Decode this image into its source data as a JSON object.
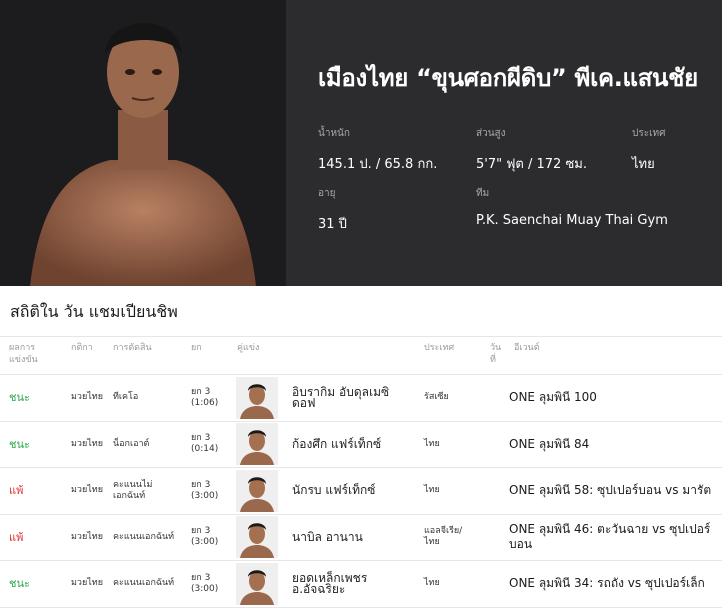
{
  "fighter": {
    "name": "เมืองไทย “ขุนศอกผีดิบ” พีเค.แสนชัย",
    "weight_label": "น้ำหนัก",
    "weight_value": "145.1 ป. / 65.8 กก.",
    "height_label": "ส่วนสูง",
    "height_value": "5'7\" ฟุต / 172 ซม.",
    "country_label": "ประเทศ",
    "country_value": "ไทย",
    "age_label": "อายุ",
    "age_value": "31 ปี",
    "team_label": "ทีม",
    "team_value": "P.K. Saenchai Muay Thai Gym"
  },
  "stats": {
    "title": "สถิติใน วัน แชมเปียนชิพ",
    "headers": {
      "result": "ผลการแข่งขัน",
      "rules": "กติกา",
      "method": "การตัดสิน",
      "round": "ยก",
      "opponent": "คู่แข่ง",
      "country": "ประเทศ",
      "date": "วันที่",
      "event": "อีเวนต์"
    },
    "rows": [
      {
        "result": "ชนะ",
        "rules": "มวยไทย",
        "method": "ทีเคโอ",
        "round": "ยก 3\n(1:06)",
        "opponent": "อิบรากิม อับดุลเมซิดอฟ",
        "country": "รัสเซีย",
        "event": "ONE ลุมพินี 100"
      },
      {
        "result": "ชนะ",
        "rules": "มวยไทย",
        "method": "น็อกเอาต์",
        "round": "ยก 3\n(0:14)",
        "opponent": "ก้องศึก แฟร์เท็กซ์",
        "country": "ไทย",
        "event": "ONE ลุมพินี 84"
      },
      {
        "result": "แพ้",
        "rules": "มวยไทย",
        "method": "คะแนนไม่\nเอกฉันท์",
        "round": "ยก 3\n(3:00)",
        "opponent": "นักรบ แฟร์เท็กซ์",
        "country": "ไทย",
        "event": "ONE ลุมพินี 58: ซุปเปอร์บอน vs มารัต"
      },
      {
        "result": "แพ้",
        "rules": "มวยไทย",
        "method": "คะแนนเอกฉันท์",
        "round": "ยก 3\n(3:00)",
        "opponent": "นาบิล อานาน",
        "country": "แอลจีเรีย/\nไทย",
        "event": "ONE ลุมพินี 46: ตะวันฉาย vs ซุปเปอร์\nบอน"
      },
      {
        "result": "ชนะ",
        "rules": "มวยไทย",
        "method": "คะแนนเอกฉันท์",
        "round": "ยก 3\n(3:00)",
        "opponent": "ยอดเหล็กเพชร\nอ.อัจฉริยะ",
        "country": "ไทย",
        "event": "ONE ลุมพินี 34: รถถัง vs ซุปเปอร์เล็ก"
      }
    ]
  },
  "colors": {
    "win": "#2aa84a",
    "loss": "#e0302f",
    "hero_bg": "#2c2c2f"
  }
}
